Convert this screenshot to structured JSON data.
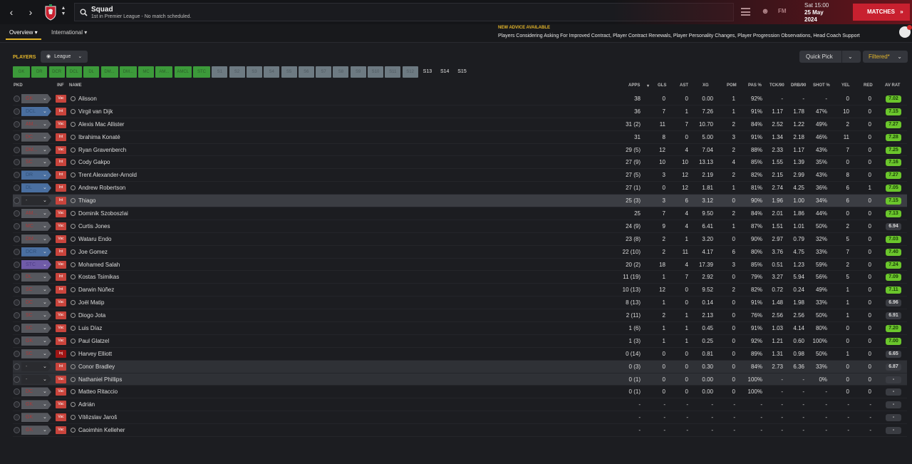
{
  "header": {
    "title": "Squad",
    "subtitle": "1st in Premier League - No match scheduled.",
    "logo_text": "FM",
    "date_time": "Sat 15:00",
    "date": "25 May",
    "year": "2024",
    "matches_label": "MATCHES",
    "matches_icon": "double-chevron-right"
  },
  "tabs": [
    {
      "label": "Overview ▾"
    },
    {
      "label": "International ▾"
    }
  ],
  "advice": {
    "title": "NEW ADVICE AVAILABLE",
    "text": "Players Considering Asking For Improved Contract, Player Contract Renewals, Player Personality Changes, Player Progression Observations, Head Coach Support"
  },
  "filters": {
    "players_label": "PLAYERS",
    "league_label": "League",
    "quick_pick_label": "Quick Pick",
    "filtered_label": "Filtered*"
  },
  "positions": [
    "GK",
    "DR",
    "DCR",
    "DCL",
    "DL",
    "DM...",
    "DM...",
    "MC",
    "AM...",
    "AMCL",
    "STC",
    "S1",
    "S2",
    "S3",
    "S4",
    "S5",
    "S6",
    "S7",
    "S8",
    "S9",
    "S10",
    "S11",
    "S12",
    "S13",
    "S14",
    "S15"
  ],
  "columns": {
    "pkd": "PKD",
    "inf": "INF",
    "name": "NAME",
    "apps": "APPS",
    "gls": "GLS",
    "ast": "AST",
    "xg": "XG",
    "pom": "POM",
    "pas": "PAS %",
    "tck": "TCK/90",
    "drb": "DRB/90",
    "shot": "SHOT %",
    "yel": "YEL",
    "red": "RED",
    "avrat": "AV RAT"
  },
  "colors": {
    "accent": "#e3b52a",
    "matches": "#c8202f",
    "rating": "#6bc62c"
  },
  "players": [
    {
      "pkd": "GK",
      "pkd_style": "grey",
      "inf": "Vac",
      "name": "Alisson",
      "apps": "38",
      "gls": "0",
      "ast": "0",
      "xg": "0.00",
      "pom": "1",
      "pas": "92%",
      "tck": "-",
      "drb": "-",
      "shot": "-",
      "yel": "0",
      "red": "0",
      "avrat": "7.02"
    },
    {
      "pkd": "DCL",
      "pkd_style": "blue",
      "inf": "Int",
      "name": "Virgil van Dijk",
      "apps": "36",
      "gls": "7",
      "ast": "1",
      "xg": "7.26",
      "pom": "1",
      "pas": "91%",
      "tck": "1.17",
      "drb": "1.78",
      "shot": "47%",
      "yel": "10",
      "red": "0",
      "avrat": "7.15"
    },
    {
      "pkd": "AM...",
      "pkd_style": "grey",
      "inf": "Vac",
      "name": "Alexis Mac Allister",
      "apps": "31 (2)",
      "gls": "11",
      "ast": "7",
      "xg": "10.70",
      "pom": "2",
      "pas": "84%",
      "tck": "2.52",
      "drb": "1.22",
      "shot": "49%",
      "yel": "2",
      "red": "0",
      "avrat": "7.27"
    },
    {
      "pkd": "DC",
      "pkd_style": "grey",
      "inf": "Int",
      "name": "Ibrahima Konaté",
      "apps": "31",
      "gls": "8",
      "ast": "0",
      "xg": "5.00",
      "pom": "3",
      "pas": "91%",
      "tck": "1.34",
      "drb": "2.18",
      "shot": "46%",
      "yel": "11",
      "red": "0",
      "avrat": "7.28"
    },
    {
      "pkd": "DM...",
      "pkd_style": "grey",
      "inf": "Vac",
      "name": "Ryan Gravenberch",
      "apps": "29 (5)",
      "gls": "12",
      "ast": "4",
      "xg": "7.04",
      "pom": "2",
      "pas": "88%",
      "tck": "2.33",
      "drb": "1.17",
      "shot": "43%",
      "yel": "7",
      "red": "0",
      "avrat": "7.25"
    },
    {
      "pkd": "SC",
      "pkd_style": "grey",
      "inf": "Int",
      "name": "Cody Gakpo",
      "apps": "27 (9)",
      "gls": "10",
      "ast": "10",
      "xg": "13.13",
      "pom": "4",
      "pas": "85%",
      "tck": "1.55",
      "drb": "1.39",
      "shot": "35%",
      "yel": "0",
      "red": "0",
      "avrat": "7.16"
    },
    {
      "pkd": "DR",
      "pkd_style": "blue",
      "inf": "Int",
      "name": "Trent Alexander-Arnold",
      "apps": "27 (5)",
      "gls": "3",
      "ast": "12",
      "xg": "2.19",
      "pom": "2",
      "pas": "82%",
      "tck": "2.15",
      "drb": "2.99",
      "shot": "43%",
      "yel": "8",
      "red": "0",
      "avrat": "7.27"
    },
    {
      "pkd": "DL",
      "pkd_style": "blue",
      "inf": "Int",
      "name": "Andrew Robertson",
      "apps": "27 (1)",
      "gls": "0",
      "ast": "12",
      "xg": "1.81",
      "pom": "1",
      "pas": "81%",
      "tck": "2.74",
      "drb": "4.25",
      "shot": "36%",
      "yel": "6",
      "red": "1",
      "avrat": "7.05"
    },
    {
      "pkd": "-",
      "pkd_style": "dark",
      "inf": "Int",
      "name": "Thiago",
      "apps": "25 (3)",
      "gls": "3",
      "ast": "6",
      "xg": "3.12",
      "pom": "0",
      "pas": "90%",
      "tck": "1.96",
      "drb": "1.00",
      "shot": "34%",
      "yel": "6",
      "red": "0",
      "avrat": "7.15",
      "row_style": "sel"
    },
    {
      "pkd": "AM...",
      "pkd_style": "grey",
      "inf": "Vac",
      "name": "Dominik Szoboszlai",
      "apps": "25",
      "gls": "7",
      "ast": "4",
      "xg": "9.50",
      "pom": "2",
      "pas": "84%",
      "tck": "2.01",
      "drb": "1.86",
      "shot": "44%",
      "yel": "0",
      "red": "0",
      "avrat": "7.13"
    },
    {
      "pkd": "MC",
      "pkd_style": "grey",
      "inf": "Vac",
      "name": "Curtis Jones",
      "apps": "24 (9)",
      "gls": "9",
      "ast": "4",
      "xg": "6.41",
      "pom": "1",
      "pas": "87%",
      "tck": "1.51",
      "drb": "1.01",
      "shot": "50%",
      "yel": "2",
      "red": "0",
      "avrat": "6.94",
      "avrat_style": "dark"
    },
    {
      "pkd": "DM...",
      "pkd_style": "grey",
      "inf": "Vac",
      "name": "Wataru Endo",
      "apps": "23 (8)",
      "gls": "2",
      "ast": "1",
      "xg": "3.20",
      "pom": "0",
      "pas": "90%",
      "tck": "2.97",
      "drb": "0.79",
      "shot": "32%",
      "yel": "5",
      "red": "0",
      "avrat": "7.03"
    },
    {
      "pkd": "DCR",
      "pkd_style": "blue",
      "inf": "Int",
      "name": "Joe Gomez",
      "apps": "22 (10)",
      "gls": "2",
      "ast": "11",
      "xg": "4.17",
      "pom": "6",
      "pas": "80%",
      "tck": "3.76",
      "drb": "4.75",
      "shot": "33%",
      "yel": "7",
      "red": "0",
      "avrat": "7.40"
    },
    {
      "pkd": "STC",
      "pkd_style": "purple",
      "inf": "Vac",
      "name": "Mohamed Salah",
      "apps": "20 (2)",
      "gls": "18",
      "ast": "4",
      "xg": "17.39",
      "pom": "3",
      "pas": "85%",
      "tck": "0.51",
      "drb": "1.23",
      "shot": "59%",
      "yel": "2",
      "red": "0",
      "avrat": "7.24"
    },
    {
      "pkd": "DL",
      "pkd_style": "grey",
      "inf": "Int",
      "name": "Kostas Tsimikas",
      "apps": "11 (19)",
      "gls": "1",
      "ast": "7",
      "xg": "2.92",
      "pom": "0",
      "pas": "79%",
      "tck": "3.27",
      "drb": "5.94",
      "shot": "56%",
      "yel": "5",
      "red": "0",
      "avrat": "7.09"
    },
    {
      "pkd": "SC",
      "pkd_style": "grey",
      "inf": "Int",
      "name": "Darwin Núñez",
      "apps": "10 (13)",
      "gls": "12",
      "ast": "0",
      "xg": "9.52",
      "pom": "2",
      "pas": "82%",
      "tck": "0.72",
      "drb": "0.24",
      "shot": "49%",
      "yel": "1",
      "red": "0",
      "avrat": "7.11"
    },
    {
      "pkd": "DC",
      "pkd_style": "grey",
      "inf": "Vac",
      "name": "Joël Matip",
      "apps": "8 (13)",
      "gls": "1",
      "ast": "0",
      "xg": "0.14",
      "pom": "0",
      "pas": "91%",
      "tck": "1.48",
      "drb": "1.98",
      "shot": "33%",
      "yel": "1",
      "red": "0",
      "avrat": "6.96",
      "avrat_style": "dark"
    },
    {
      "pkd": "SC",
      "pkd_style": "grey",
      "inf": "Vac",
      "name": "Diogo Jota",
      "apps": "2 (11)",
      "gls": "2",
      "ast": "1",
      "xg": "2.13",
      "pom": "0",
      "pas": "76%",
      "tck": "2.56",
      "drb": "2.56",
      "shot": "50%",
      "yel": "1",
      "red": "0",
      "avrat": "6.91",
      "avrat_style": "dark"
    },
    {
      "pkd": "SC",
      "pkd_style": "grey",
      "inf": "Vac",
      "name": "Luis Díaz",
      "apps": "1 (6)",
      "gls": "1",
      "ast": "1",
      "xg": "0.45",
      "pom": "0",
      "pas": "91%",
      "tck": "1.03",
      "drb": "4.14",
      "shot": "80%",
      "yel": "0",
      "red": "0",
      "avrat": "7.20"
    },
    {
      "pkd": "GK",
      "pkd_style": "grey",
      "inf": "Vac",
      "name": "Paul Glatzel",
      "apps": "1 (3)",
      "gls": "1",
      "ast": "1",
      "xg": "0.25",
      "pom": "0",
      "pas": "92%",
      "tck": "1.21",
      "drb": "0.60",
      "shot": "100%",
      "yel": "0",
      "red": "0",
      "avrat": "7.00"
    },
    {
      "pkd": "SC",
      "pkd_style": "grey",
      "inf": "Inj",
      "name": "Harvey Elliott",
      "apps": "0 (14)",
      "gls": "0",
      "ast": "0",
      "xg": "0.81",
      "pom": "0",
      "pas": "89%",
      "tck": "1.31",
      "drb": "0.98",
      "shot": "50%",
      "yel": "1",
      "red": "0",
      "avrat": "6.65",
      "avrat_style": "dark"
    },
    {
      "pkd": "-",
      "pkd_style": "dark",
      "inf": "Int",
      "name": "Conor Bradley",
      "apps": "0 (3)",
      "gls": "0",
      "ast": "0",
      "xg": "0.30",
      "pom": "0",
      "pas": "84%",
      "tck": "2.73",
      "drb": "6.36",
      "shot": "33%",
      "yel": "0",
      "red": "0",
      "avrat": "6.87",
      "avrat_style": "dark",
      "row_style": "hl"
    },
    {
      "pkd": "-",
      "pkd_style": "dark",
      "inf": "Vac",
      "name": "Nathaniel Phillips",
      "apps": "0 (1)",
      "gls": "0",
      "ast": "0",
      "xg": "0.00",
      "pom": "0",
      "pas": "100%",
      "tck": "-",
      "drb": "-",
      "shot": "0%",
      "yel": "0",
      "red": "0",
      "avrat": "-",
      "avrat_style": "dark",
      "row_style": "hl"
    },
    {
      "pkd": "DC",
      "pkd_style": "grey",
      "inf": "Vac",
      "name": "Matteo Ritaccio",
      "apps": "0 (1)",
      "gls": "0",
      "ast": "0",
      "xg": "0.00",
      "pom": "0",
      "pas": "100%",
      "tck": "-",
      "drb": "-",
      "shot": "-",
      "yel": "0",
      "red": "0",
      "avrat": "-",
      "avrat_style": "dark"
    },
    {
      "pkd": "GK",
      "pkd_style": "grey",
      "inf": "Vac",
      "name": "Adrián",
      "apps": "-",
      "gls": "-",
      "ast": "-",
      "xg": "-",
      "pom": "-",
      "pas": "-",
      "tck": "-",
      "drb": "-",
      "shot": "-",
      "yel": "-",
      "red": "-",
      "avrat": "-",
      "avrat_style": "dark"
    },
    {
      "pkd": "GK",
      "pkd_style": "grey",
      "inf": "Vac",
      "name": "Vítězslav Jaroš",
      "apps": "-",
      "gls": "-",
      "ast": "-",
      "xg": "-",
      "pom": "-",
      "pas": "-",
      "tck": "-",
      "drb": "-",
      "shot": "-",
      "yel": "-",
      "red": "-",
      "avrat": "-",
      "avrat_style": "dark"
    },
    {
      "pkd": "GK",
      "pkd_style": "grey",
      "inf": "Vac",
      "name": "Caoimhin Kelleher",
      "apps": "-",
      "gls": "-",
      "ast": "-",
      "xg": "-",
      "pom": "-",
      "pas": "-",
      "tck": "-",
      "drb": "-",
      "shot": "-",
      "yel": "-",
      "red": "-",
      "avrat": "-",
      "avrat_style": "dark"
    }
  ]
}
